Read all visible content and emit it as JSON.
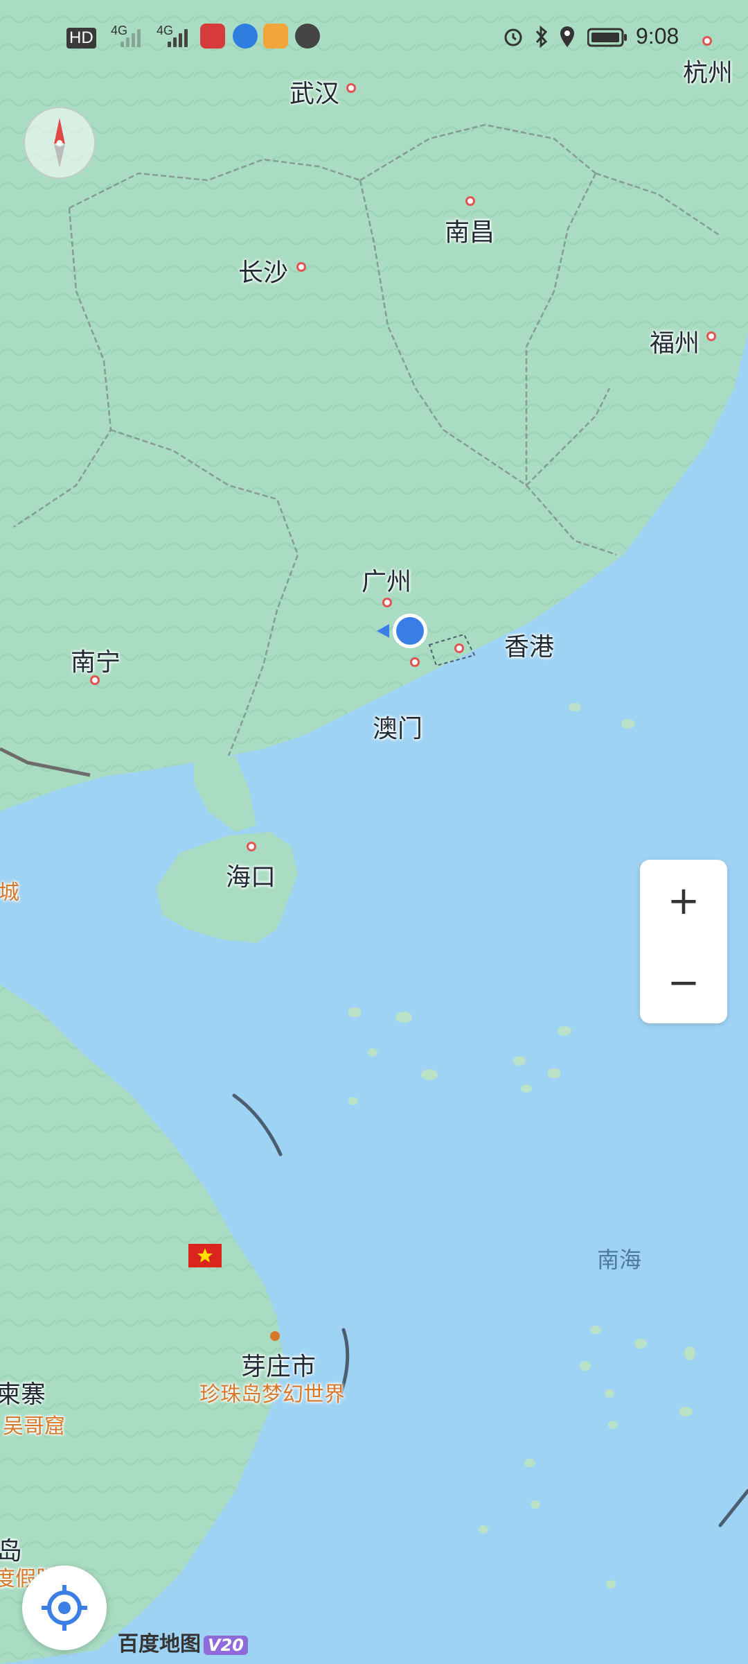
{
  "status_bar": {
    "hd": "HD",
    "sim1": "4G",
    "sim2": "4G",
    "time": "9:08"
  },
  "map": {
    "colors": {
      "sea": "#9fd3f4",
      "land": "#a7dac0",
      "land_dark": "#8cc6a6",
      "border": "#7a8a8a"
    },
    "cities": {
      "wuhan": "武汉",
      "hangzhou": "杭州",
      "nanchang": "南昌",
      "changsha": "长沙",
      "fuzhou": "福州",
      "guangzhou": "广州",
      "hongkong": "香港",
      "nanning": "南宁",
      "macau": "澳门",
      "haikou": "海口",
      "nhatrang": "芽庄市",
      "vinpearl": "珍珠岛梦幻世界",
      "cambodia": "柬寨",
      "angkor": "吴哥窟",
      "left_cheng": "城",
      "left_dao": "岛",
      "left_bottom": "度假胜地"
    },
    "sea_label": "南海",
    "flag": "vietnam-flag"
  },
  "controls": {
    "zoom_in": "+",
    "zoom_out": "−",
    "compass": "compass-icon",
    "locate": "locate-icon"
  },
  "brand": {
    "name": "百度地图",
    "version": "V20"
  }
}
